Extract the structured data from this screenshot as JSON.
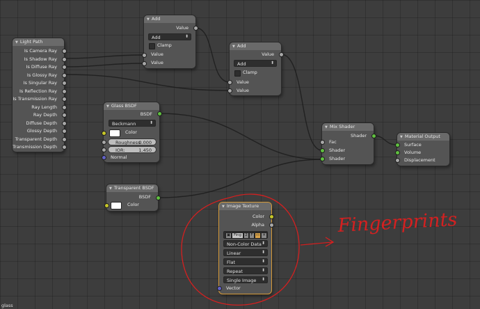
{
  "nodes": {
    "light_path": {
      "title": "Light Path",
      "outputs": [
        "Is Camera Ray",
        "Is Shadow Ray",
        "Is Diffuse Ray",
        "Is Glossy Ray",
        "Is Singular Ray",
        "Is Reflection Ray",
        "Is Transmission Ray",
        "Ray Length",
        "Ray Depth",
        "Diffuse Depth",
        "Glossy Depth",
        "Transparent Depth",
        "Transmission Depth"
      ]
    },
    "add1": {
      "title": "Add",
      "output": "Value",
      "operation": "Add",
      "clamp": "Clamp",
      "inputs": [
        "Value",
        "Value"
      ]
    },
    "add2": {
      "title": "Add",
      "output": "Value",
      "operation": "Add",
      "clamp": "Clamp",
      "inputs": [
        "Value",
        "Value"
      ]
    },
    "glass": {
      "title": "Glass BSDF",
      "output": "BSDF",
      "distribution": "Beckmann",
      "color_label": "Color",
      "roughness_label": "Roughness:",
      "roughness_value": "0.000",
      "ior_label": "IOR:",
      "ior_value": "1.450",
      "normal_label": "Normal"
    },
    "transparent": {
      "title": "Transparent BSDF",
      "output": "BSDF",
      "color_label": "Color"
    },
    "mix": {
      "title": "Mix Shader",
      "output": "Shader",
      "inputs": [
        "Fac",
        "Shader",
        "Shader"
      ]
    },
    "output": {
      "title": "Material Output",
      "inputs": [
        "Surface",
        "Volume",
        "Displacement"
      ]
    },
    "image": {
      "title": "Image Texture",
      "outputs": [
        "Color",
        "Alpha"
      ],
      "image_name": "Fing",
      "users": "2",
      "fake_user": "F",
      "color_space": "Non-Color Data",
      "interpolation": "Linear",
      "projection": "Flat",
      "extension": "Repeat",
      "source": "Single Image",
      "vector_label": "Vector"
    }
  },
  "annotation": {
    "text": "Fingerprints",
    "color": "#d42020"
  },
  "status": {
    "material_name": "glass"
  },
  "colors": {
    "shader_socket": "#60c040",
    "float_socket": "#a8a8a8",
    "color_socket": "#c7c729",
    "vector_socket": "#6363c7",
    "selected_outline": "#d59a3a"
  },
  "icons": {
    "collapse": "triangle-down-icon",
    "dropdown": "up-down-arrows-icon",
    "image_browse": "image-icon",
    "open": "folder-icon",
    "unlink": "x-icon"
  }
}
